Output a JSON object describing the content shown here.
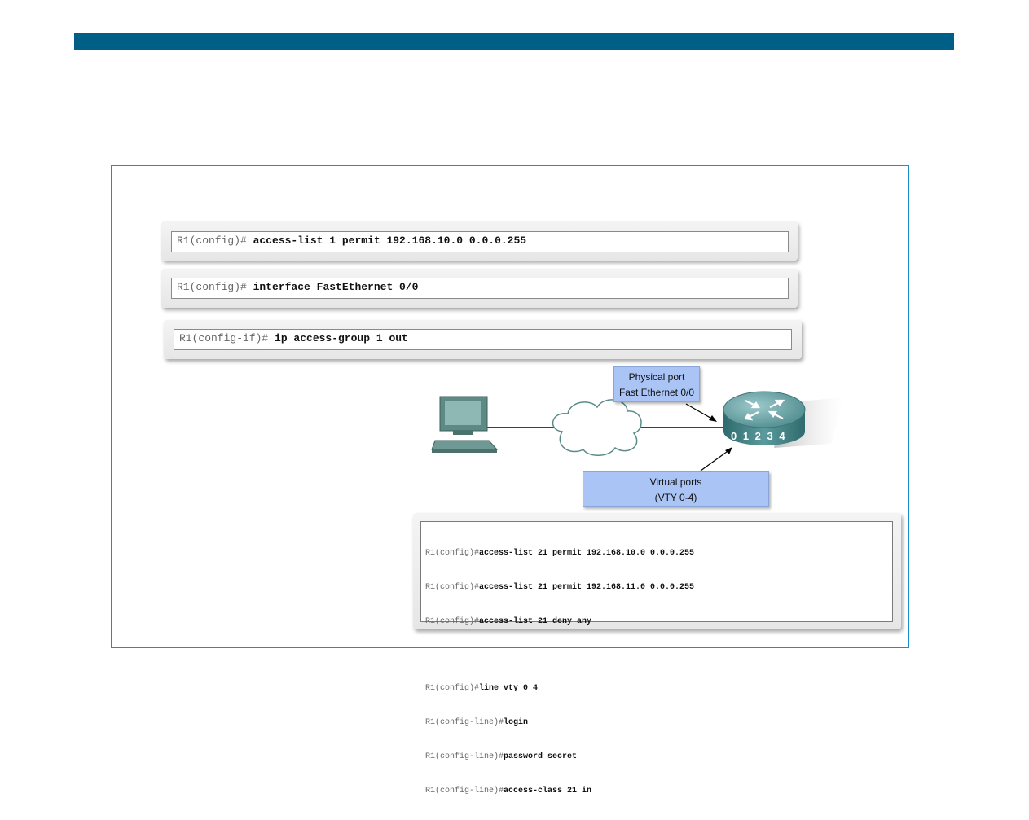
{
  "commands": [
    {
      "prompt": "R1(config)#",
      "cmd": " access-list 1 permit 192.168.10.0 0.0.0.255"
    },
    {
      "prompt": "R1(config)#",
      "cmd": " interface FastEthernet 0/0"
    },
    {
      "prompt": "R1(config-if)#",
      "cmd": " ip access-group 1 out"
    }
  ],
  "callouts": {
    "physical": [
      "Physical port",
      "Fast Ethernet 0/0"
    ],
    "virtual": [
      "Virtual ports",
      "(VTY 0-4)"
    ]
  },
  "router_ports": "0 1 2 3 4",
  "vty_config": {
    "group1": [
      {
        "prompt": "R1(config)#",
        "cmd": "access-list 21 permit 192.168.10.0 0.0.0.255"
      },
      {
        "prompt": "R1(config)#",
        "cmd": "access-list 21 permit 192.168.11.0 0.0.0.255"
      },
      {
        "prompt": "R1(config)#",
        "cmd": "access-list 21 deny any"
      }
    ],
    "group2": [
      {
        "prompt": "R1(config)#",
        "cmd": "line vty 0 4"
      },
      {
        "prompt": "R1(config-line)#",
        "cmd": "login"
      },
      {
        "prompt": "R1(config-line)#",
        "cmd": "password secret"
      },
      {
        "prompt": "R1(config-line)#",
        "cmd": "access-class 21 in"
      }
    ]
  },
  "colors": {
    "header_bar": "#005f87",
    "frame": "#1a8fc9",
    "callout": "#a9c4f5",
    "router": "#4d8a8c"
  }
}
